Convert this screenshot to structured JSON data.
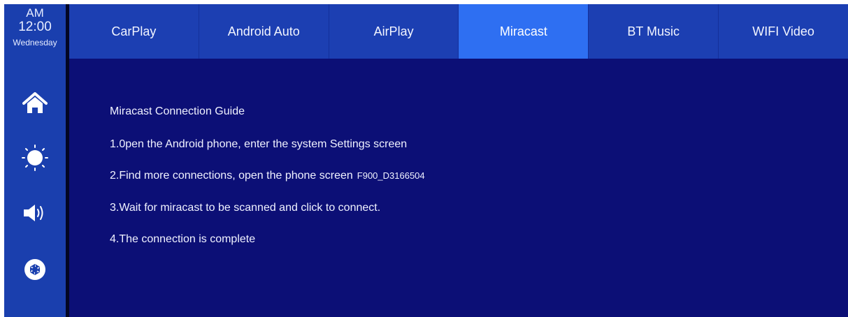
{
  "status": {
    "ampm": "AM",
    "time": "12:00",
    "day": "Wednesday"
  },
  "sidebar": {
    "buttons": [
      {
        "icon": "home-icon"
      },
      {
        "icon": "brightness-icon"
      },
      {
        "icon": "volume-icon"
      },
      {
        "icon": "aperture-icon"
      }
    ]
  },
  "tabs": [
    {
      "label": "CarPlay"
    },
    {
      "label": "Android Auto"
    },
    {
      "label": "AirPlay"
    },
    {
      "label": "Miracast",
      "active": true
    },
    {
      "label": "BT Music"
    },
    {
      "label": "WIFI Video"
    }
  ],
  "guide": {
    "title": "Miracast Connection Guide",
    "step1": "1.0pen the Android phone, enter the system Settings screen",
    "step2": "2.Find more connections, open the phone screen",
    "device_code": "F900_D3166504",
    "step3": "3.Wait for miracast to be scanned and click to connect.",
    "step4": "4.The connection is complete"
  },
  "colors": {
    "background": "#0c0f76",
    "tabbar": "#1c3fb2",
    "active_tab": "#2e6ff2",
    "sidebar": "#1a3fae"
  }
}
